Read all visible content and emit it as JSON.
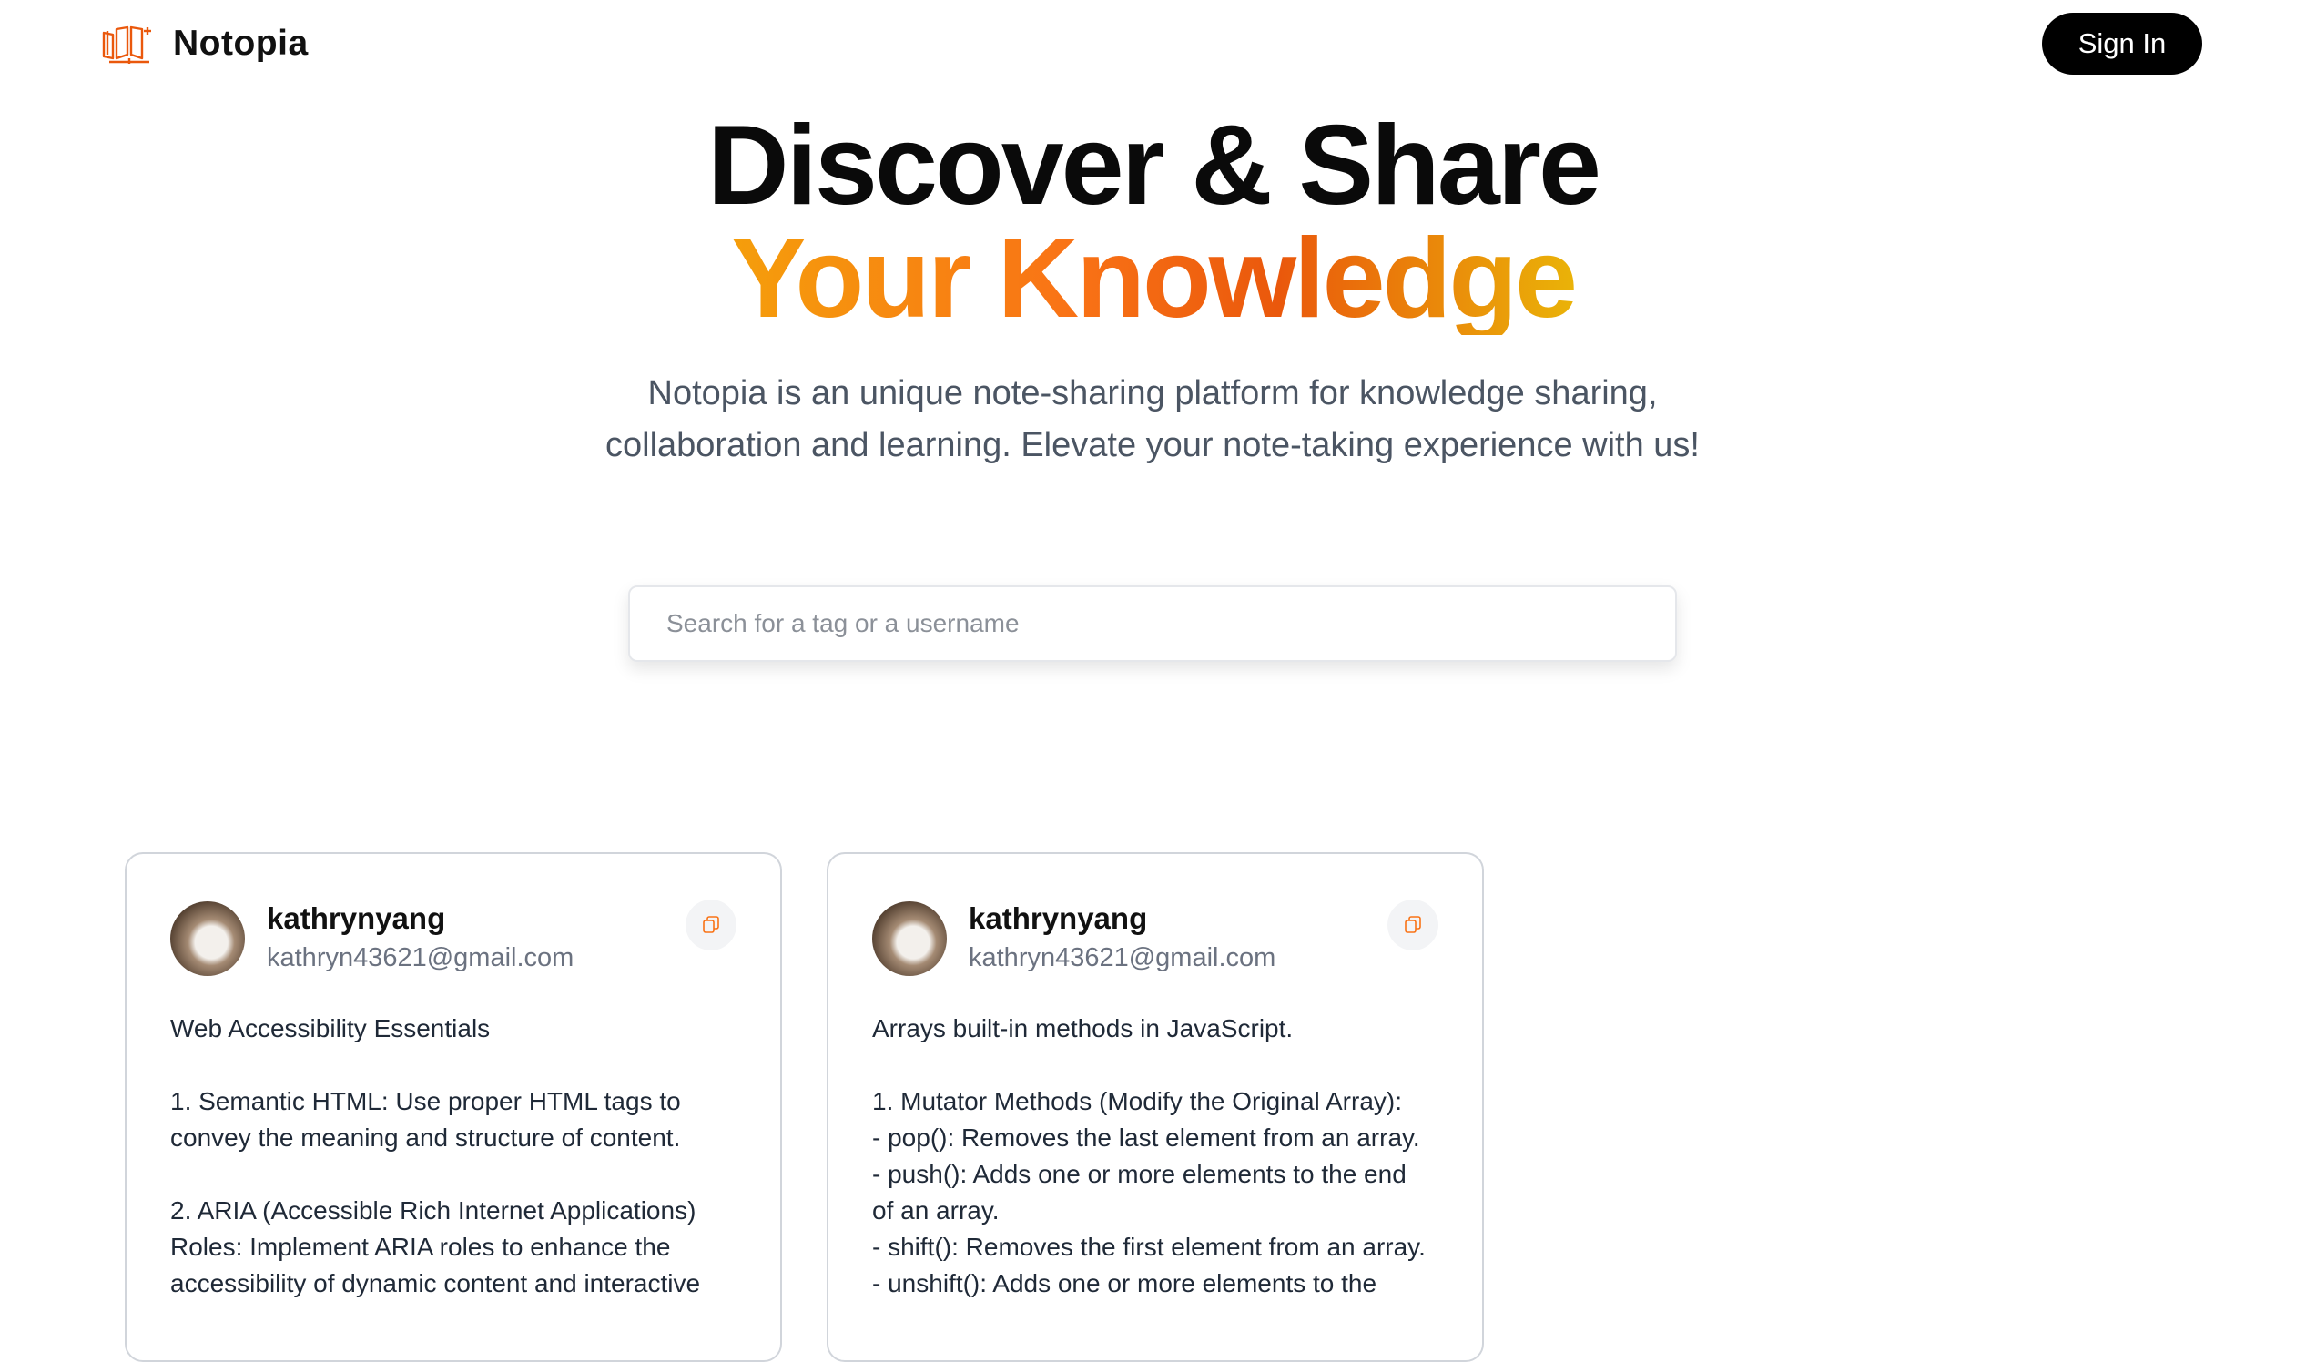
{
  "nav": {
    "brand": "Notopia",
    "signin_label": "Sign In"
  },
  "hero": {
    "title_line1": "Discover & Share",
    "title_line2": "Your Knowledge",
    "subtitle_line1": "Notopia is an unique note-sharing platform for knowledge sharing,",
    "subtitle_line2": "collaboration and learning. Elevate your note-taking experience with us!"
  },
  "search": {
    "placeholder": "Search for a tag or a username",
    "value": ""
  },
  "cards": [
    {
      "username": "kathrynyang",
      "email": "kathryn43621@gmail.com",
      "content": "Web Accessibility Essentials\n\n1. Semantic HTML: Use proper HTML tags to\nconvey the meaning and structure of content.\n\n2. ARIA (Accessible Rich Internet Applications)\nRoles: Implement ARIA roles to enhance the\naccessibility of dynamic content and interactive"
    },
    {
      "username": "kathrynyang",
      "email": "kathryn43621@gmail.com",
      "content": "Arrays built-in methods in JavaScript.\n\n1. Mutator Methods (Modify the Original Array):\n- pop(): Removes the last element from an array.\n- push(): Adds one or more elements to the end\nof an array.\n- shift(): Removes the first element from an array.\n- unshift(): Adds one or more elements to the"
    }
  ],
  "colors": {
    "accent_orange": "#f97316",
    "gradient": [
      "#f59e0b",
      "#ea580c",
      "#eab308"
    ],
    "signin_bg": "#000000"
  },
  "icons": [
    "notopia-logo-icon",
    "copy-icon"
  ]
}
